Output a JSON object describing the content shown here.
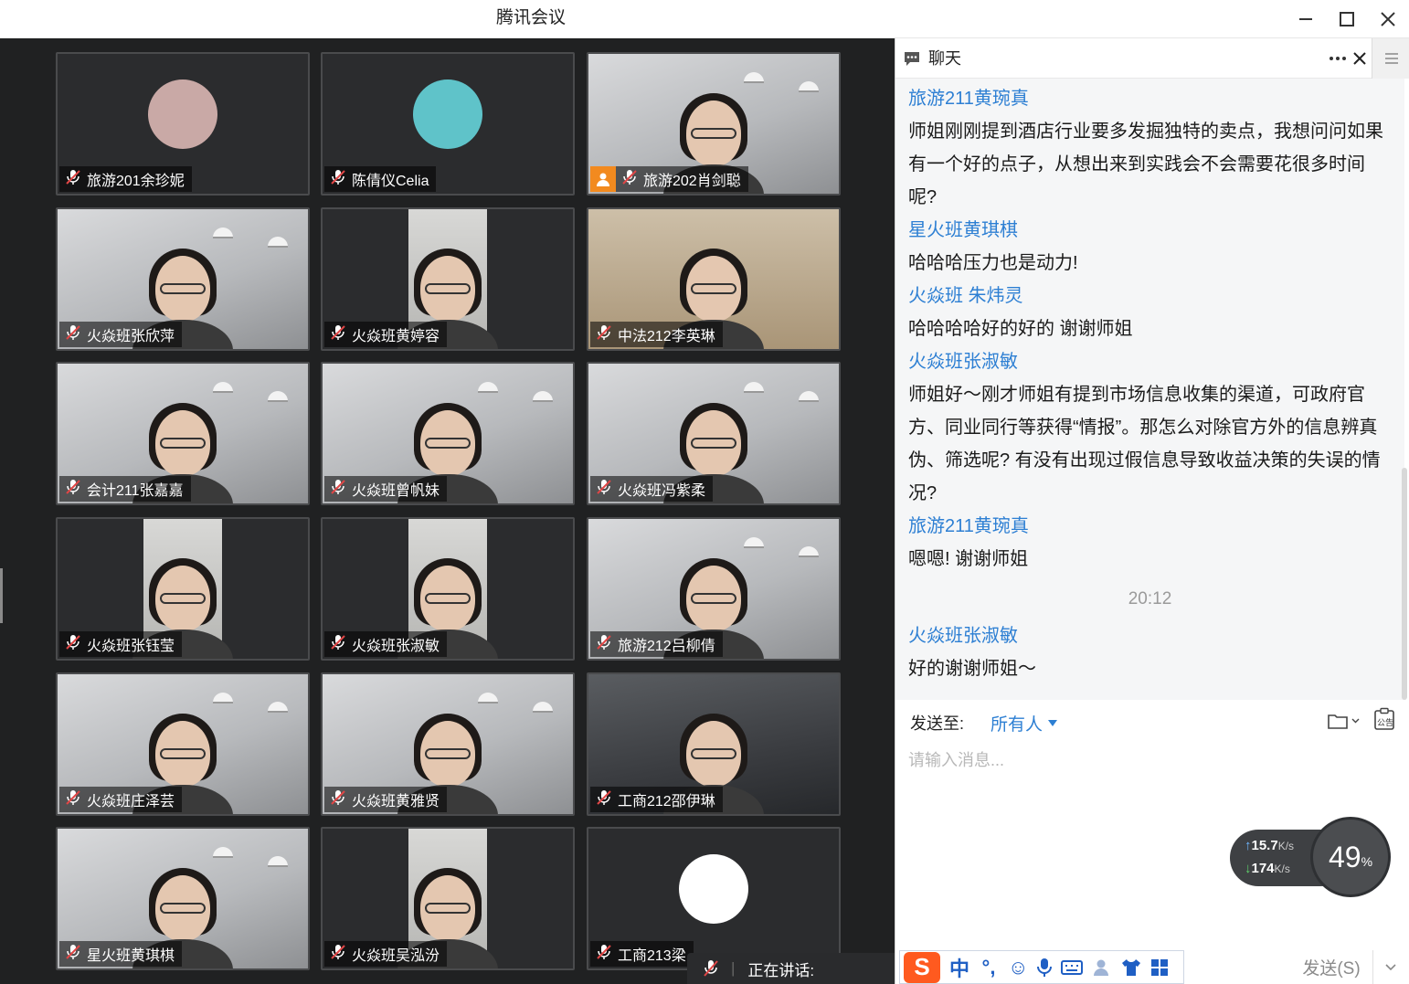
{
  "window": {
    "title": "腾讯会议"
  },
  "participants": [
    {
      "name": "旅游201余珍妮",
      "kind": "avatar",
      "avatar_color": "#c9a9a6"
    },
    {
      "name": "陈倩仪Celia",
      "kind": "avatar",
      "avatar_color": "#5fc3c9"
    },
    {
      "name": "旅游202肖剑聪",
      "kind": "video",
      "host": true
    },
    {
      "name": "火焱班张欣萍",
      "kind": "video"
    },
    {
      "name": "火焱班黄婷容",
      "kind": "narrow"
    },
    {
      "name": "中法212李英琳",
      "kind": "shelf"
    },
    {
      "name": "会计211张嘉嘉",
      "kind": "video"
    },
    {
      "name": "火焱班曾帆妹",
      "kind": "video"
    },
    {
      "name": "火焱班冯紫柔",
      "kind": "video"
    },
    {
      "name": "火焱班张钰莹",
      "kind": "narrow"
    },
    {
      "name": "火焱班张淑敏",
      "kind": "narrow"
    },
    {
      "name": "旅游212吕柳倩",
      "kind": "video"
    },
    {
      "name": "火焱班庄泽芸",
      "kind": "video"
    },
    {
      "name": "火焱班黄雅贤",
      "kind": "video"
    },
    {
      "name": "工商212邵伊琳",
      "kind": "dark"
    },
    {
      "name": "星火班黄琪棋",
      "kind": "video"
    },
    {
      "name": "火焱班吴泓汾",
      "kind": "narrow"
    },
    {
      "name": "工商213梁",
      "kind": "avatar",
      "avatar_color": "#ffffff"
    }
  ],
  "speaking": {
    "label": "正在讲话:"
  },
  "chat": {
    "title": "聊天",
    "messages": [
      {
        "sender": "旅游211黄琬真",
        "text": "师姐刚刚提到酒店行业要多发掘独特的卖点，我想问问如果有一个好的点子，从想出来到实践会不会需要花很多时间呢?"
      },
      {
        "sender": "星火班黄琪棋",
        "text": "哈哈哈压力也是动力!"
      },
      {
        "sender": "火焱班 朱炜灵",
        "text": "哈哈哈哈好的好的 谢谢师姐"
      },
      {
        "sender": "火焱班张淑敏",
        "text": "师姐好～刚才师姐有提到市场信息收集的渠道，可政府官方、同业同行等获得“情报”。那怎么对除官方外的信息辨真伪、筛选呢? 有没有出现过假信息导致收益决策的失误的情况?"
      },
      {
        "sender": "旅游211黄琬真",
        "text": "嗯嗯! 谢谢师姐"
      }
    ],
    "time_divider": "20:12",
    "messages_after": [
      {
        "sender": "火焱班张淑敏",
        "text": "好的谢谢师姐～"
      }
    ],
    "send_to_label": "发送至:",
    "send_to_value": "所有人",
    "input_placeholder": "请输入消息...",
    "send_button": "发送(S)",
    "announcement_label": "公告"
  },
  "network": {
    "upload": "15.7",
    "download": "174",
    "unit": "K/s",
    "cpu_percent": "49",
    "percent_sign": "%"
  },
  "ime": {
    "mode_label": "中",
    "punct_label": "°,"
  }
}
